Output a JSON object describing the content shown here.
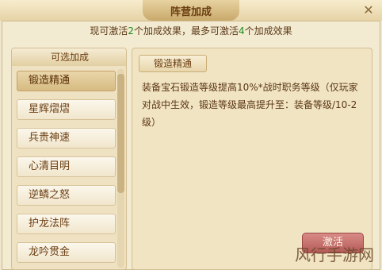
{
  "window": {
    "title": "阵营加成",
    "close_icon": "close-icon"
  },
  "summary": {
    "prefix": "现可激活",
    "current": "2",
    "mid": "个加成效果，最多可激活",
    "max": "4",
    "suffix": "个加成效果"
  },
  "sidebar": {
    "header": "可选加成",
    "items": [
      {
        "label": "锻造精通",
        "selected": true
      },
      {
        "label": "星辉熠熠"
      },
      {
        "label": "兵贵神速"
      },
      {
        "label": "心清目明"
      },
      {
        "label": "逆鳞之怒"
      },
      {
        "label": "护龙法阵"
      },
      {
        "label": "龙吟贯金"
      }
    ]
  },
  "detail": {
    "title": "锻造精通",
    "description": "装备宝石锻造等级提高10%*战时职务等级（仅玩家对战中生效，锻造等级最高提升至：装备等级/10-2级）"
  },
  "actions": {
    "activate_label": "激活"
  },
  "watermark": "风行手游网"
}
